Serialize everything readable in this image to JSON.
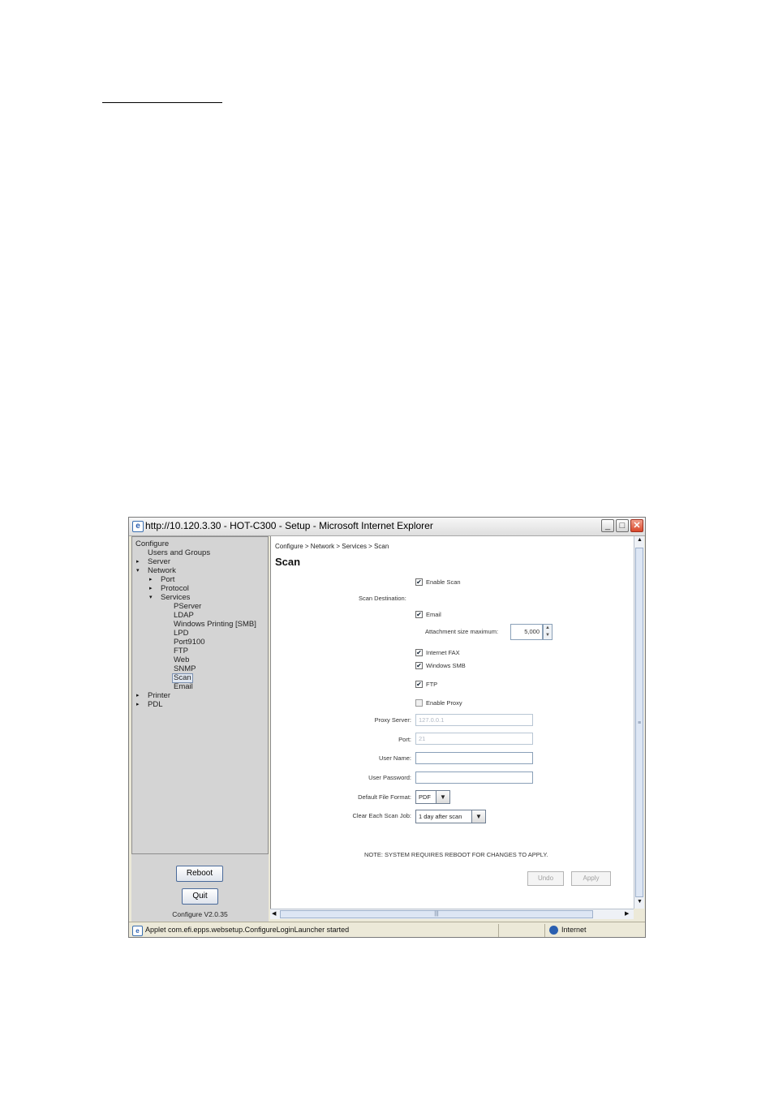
{
  "window": {
    "title": "http://10.120.3.30 - HOT-C300 - Setup - Microsoft Internet Explorer",
    "min_symbol": "_",
    "max_symbol": "□",
    "close_symbol": "✕"
  },
  "tree": {
    "items": [
      {
        "label": "Configure"
      },
      {
        "label": "Users and Groups"
      },
      {
        "label": "Server",
        "arrow": "▸"
      },
      {
        "label": "Network",
        "arrow": "▾"
      },
      {
        "label": "Port",
        "arrow": "▸"
      },
      {
        "label": "Protocol",
        "arrow": "▸"
      },
      {
        "label": "Services",
        "arrow": "▾"
      },
      {
        "label": "PServer"
      },
      {
        "label": "LDAP"
      },
      {
        "label": "Windows Printing [SMB]"
      },
      {
        "label": "LPD"
      },
      {
        "label": "Port9100"
      },
      {
        "label": "FTP"
      },
      {
        "label": "Web"
      },
      {
        "label": "SNMP"
      },
      {
        "label": "Scan",
        "selected": true
      },
      {
        "label": "Email"
      },
      {
        "label": "Printer",
        "arrow": "▸"
      },
      {
        "label": "PDL",
        "arrow": "▸"
      }
    ]
  },
  "left_footer": {
    "reboot_label": "Reboot",
    "quit_label": "Quit",
    "version": "Configure V2.0.35"
  },
  "content": {
    "breadcrumb": "Configure > Network > Services > Scan",
    "title": "Scan",
    "enable_scan": {
      "label": "Enable Scan",
      "checked": true
    },
    "scan_destination_label": "Scan Destination:",
    "email": {
      "label": "Email",
      "checked": true
    },
    "attachment": {
      "label": "Attachment size maximum:",
      "value": "5,000"
    },
    "internet_fax": {
      "label": "Internet FAX",
      "checked": true
    },
    "windows_smb": {
      "label": "Windows SMB",
      "checked": true
    },
    "ftp": {
      "label": "FTP",
      "checked": true
    },
    "enable_proxy": {
      "label": "Enable Proxy",
      "checked": false
    },
    "proxy_server": {
      "label": "Proxy Server:",
      "value": "127.0.0.1"
    },
    "port": {
      "label": "Port:",
      "value": "21"
    },
    "user_name": {
      "label": "User Name:",
      "value": ""
    },
    "user_password": {
      "label": "User Password:",
      "value": ""
    },
    "default_file_format": {
      "label": "Default File Format:",
      "value": "PDF"
    },
    "clear_each_scan_job": {
      "label": "Clear Each Scan Job:",
      "value": "1 day after scan"
    },
    "note": "NOTE: SYSTEM REQUIRES REBOOT FOR CHANGES TO APPLY.",
    "undo_label": "Undo",
    "apply_label": "Apply",
    "check_symbol": "✔"
  },
  "statusbar": {
    "text": "Applet com.efi.epps.websetup.ConfigureLoginLauncher started",
    "zone": "Internet"
  }
}
